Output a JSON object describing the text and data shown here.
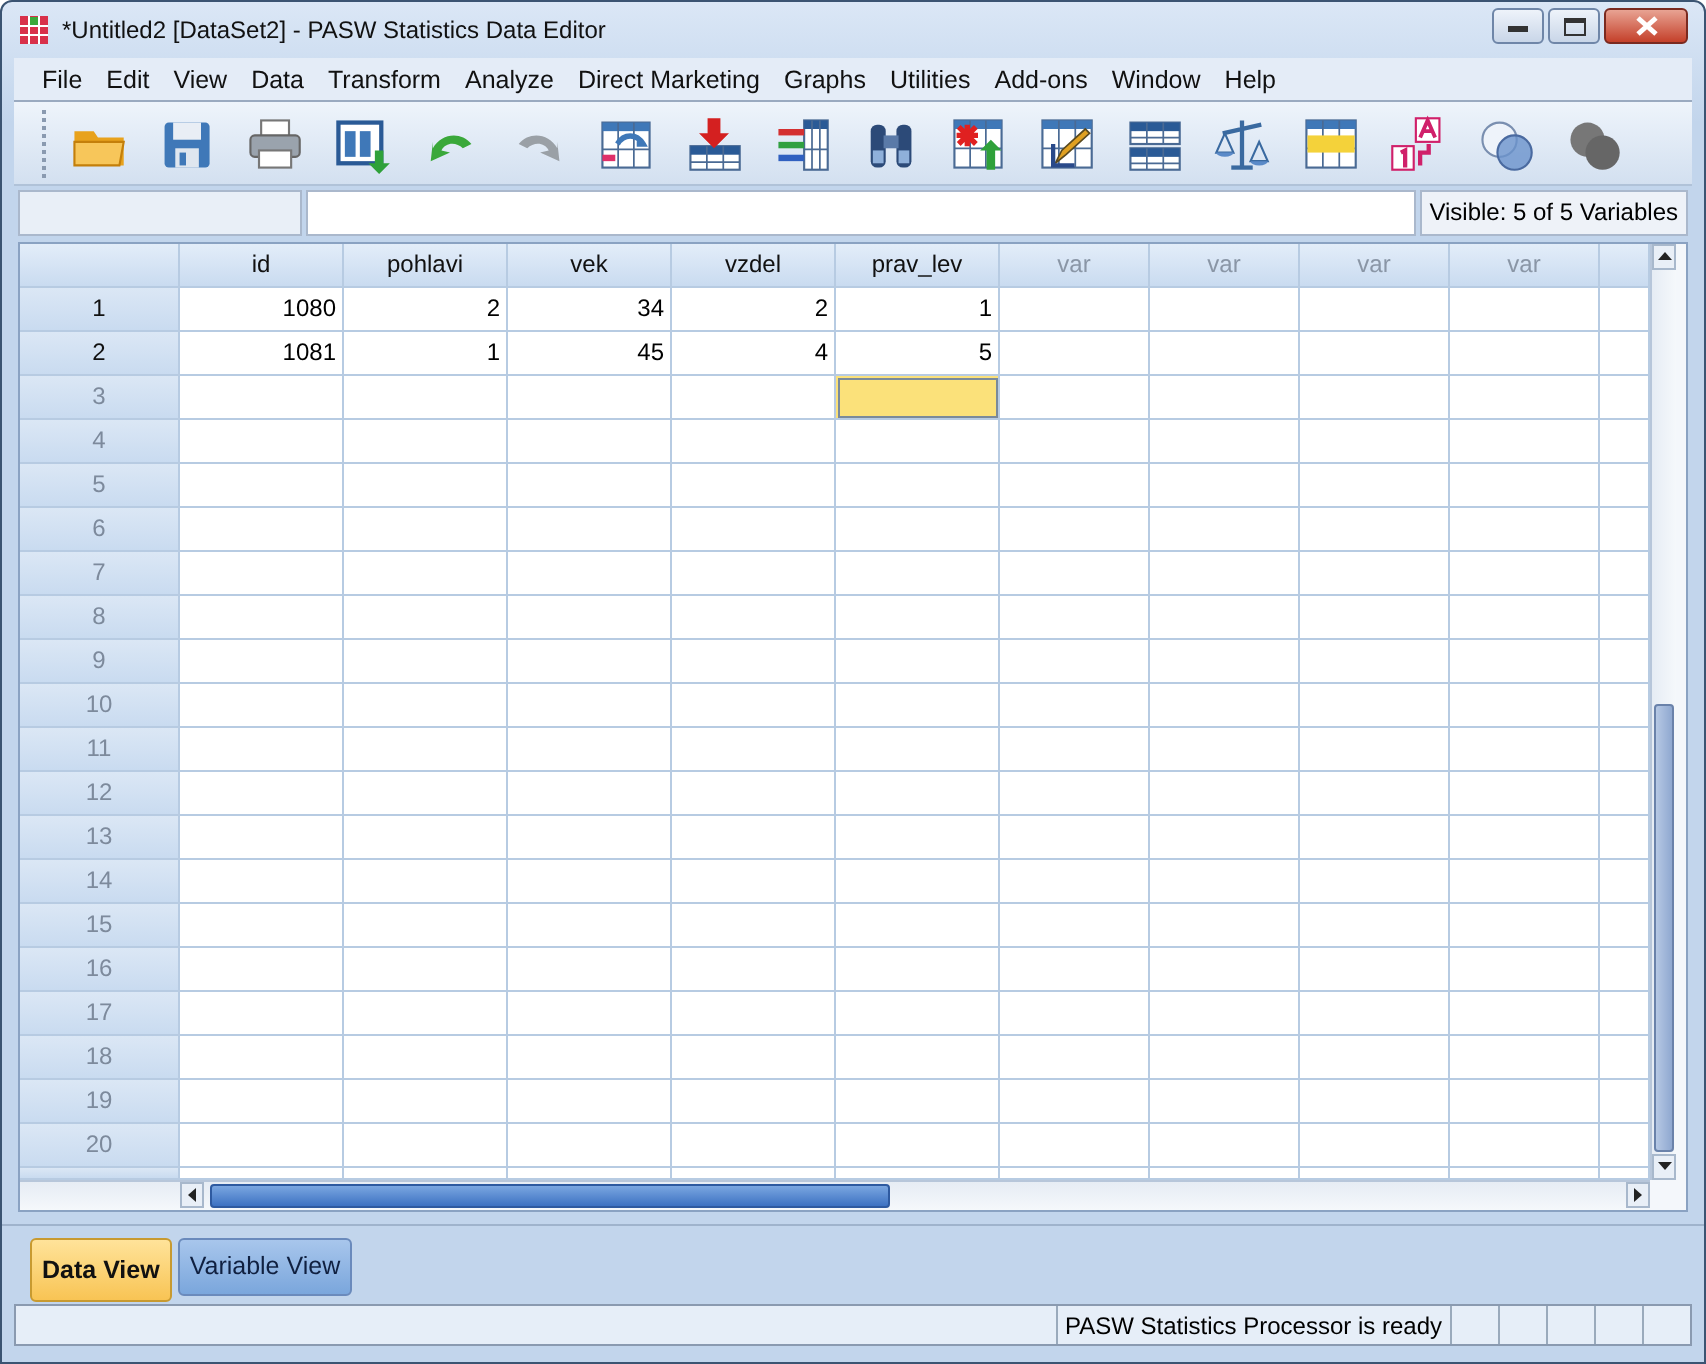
{
  "window": {
    "title": "*Untitled2 [DataSet2] - PASW Statistics Data Editor"
  },
  "menu": [
    "File",
    "Edit",
    "View",
    "Data",
    "Transform",
    "Analyze",
    "Direct Marketing",
    "Graphs",
    "Utilities",
    "Add-ons",
    "Window",
    "Help"
  ],
  "visible_variables": "Visible: 5 of 5 Variables",
  "columns": [
    {
      "name": "id",
      "kind": "variable"
    },
    {
      "name": "pohlavi",
      "kind": "variable"
    },
    {
      "name": "vek",
      "kind": "variable"
    },
    {
      "name": "vzdel",
      "kind": "variable"
    },
    {
      "name": "prav_lev",
      "kind": "variable"
    },
    {
      "name": "var",
      "kind": "placeholder"
    },
    {
      "name": "var",
      "kind": "placeholder"
    },
    {
      "name": "var",
      "kind": "placeholder"
    },
    {
      "name": "var",
      "kind": "placeholder"
    }
  ],
  "rows": [
    {
      "label": "1",
      "cells": [
        {
          "value": "1080",
          "selected": false
        },
        {
          "value": "2",
          "selected": false
        },
        {
          "value": "34",
          "selected": false
        },
        {
          "value": "2",
          "selected": false
        },
        {
          "value": "1",
          "selected": false
        }
      ]
    },
    {
      "label": "2",
      "cells": [
        {
          "value": "1081",
          "selected": false
        },
        {
          "value": "1",
          "selected": false
        },
        {
          "value": "45",
          "selected": false
        },
        {
          "value": "4",
          "selected": false
        },
        {
          "value": "5",
          "selected": false
        }
      ]
    },
    {
      "label": "3",
      "cells": [
        {
          "selected": false
        },
        {
          "selected": false
        },
        {
          "selected": false
        },
        {
          "selected": false
        },
        {
          "selected": true
        }
      ]
    },
    {
      "label": "4"
    },
    {
      "label": "5"
    },
    {
      "label": "6"
    },
    {
      "label": "7"
    },
    {
      "label": "8"
    },
    {
      "label": "9"
    },
    {
      "label": "10"
    },
    {
      "label": "11"
    },
    {
      "label": "12"
    },
    {
      "label": "13"
    },
    {
      "label": "14"
    },
    {
      "label": "15"
    },
    {
      "label": "16"
    },
    {
      "label": "17"
    },
    {
      "label": "18"
    },
    {
      "label": "19"
    },
    {
      "label": "20"
    }
  ],
  "view_tabs": [
    {
      "label": "Data View",
      "selected": true
    },
    {
      "label": "Variable View",
      "selected": false
    }
  ],
  "status_bar": {
    "message": "PASW Statistics Processor is ready"
  }
}
